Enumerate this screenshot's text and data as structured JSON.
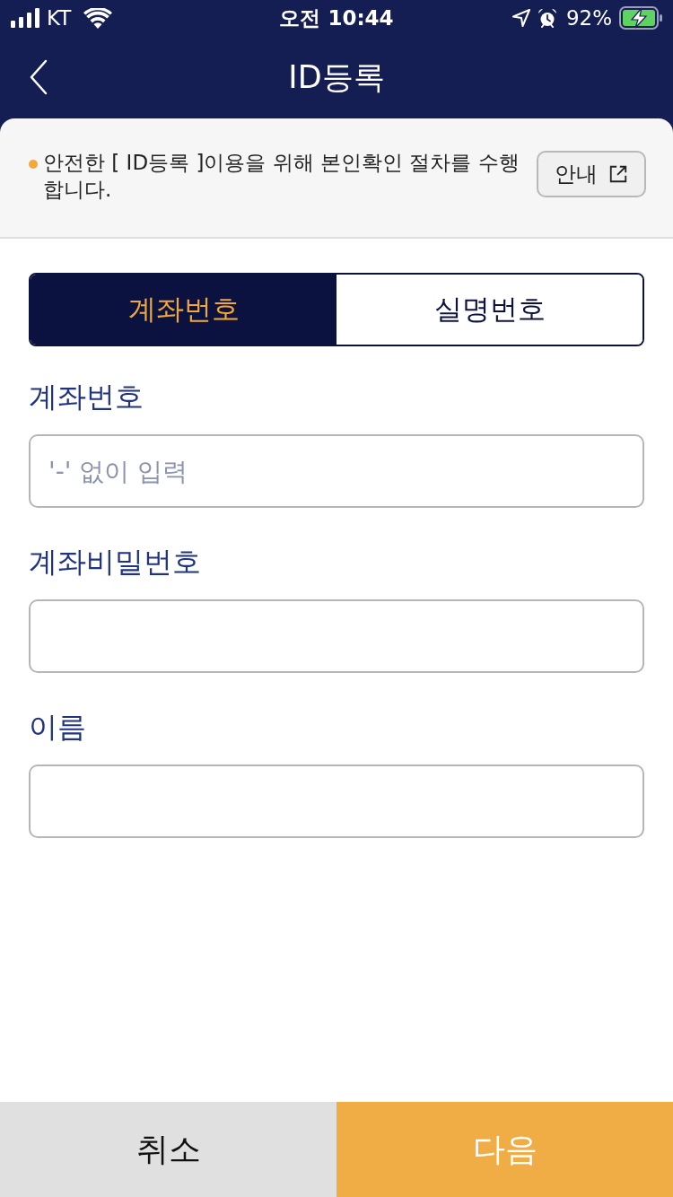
{
  "status_bar": {
    "carrier": "KT",
    "time": "오전 10:44",
    "battery": "92%"
  },
  "header": {
    "title": "ID등록"
  },
  "notice": {
    "text": "안전한 [ ID등록 ]이용을 위해 본인확인 절차를 수행합니다.",
    "button": "안내"
  },
  "tabs": [
    {
      "label": "계좌번호",
      "selected": true
    },
    {
      "label": "실명번호",
      "selected": false
    }
  ],
  "fields": [
    {
      "label": "계좌번호",
      "placeholder": "'-' 없이 입력"
    },
    {
      "label": "계좌비밀번호"
    },
    {
      "label": "이름"
    }
  ],
  "buttons": [
    {
      "label": "취소",
      "kind": "cancel"
    },
    {
      "label": "다음",
      "kind": "primary"
    }
  ]
}
